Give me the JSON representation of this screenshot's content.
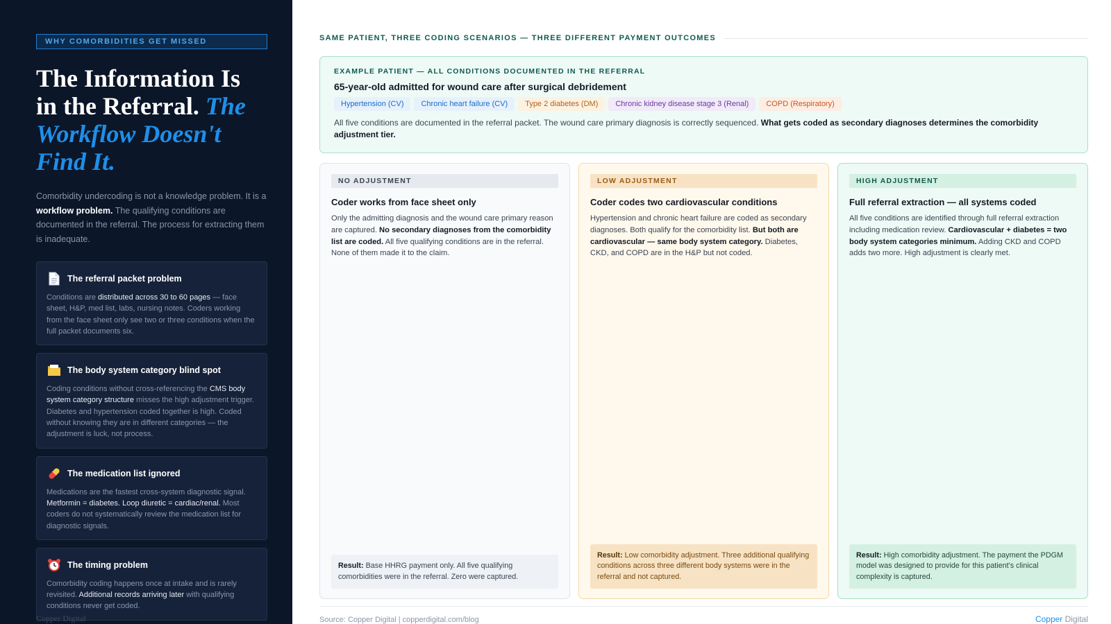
{
  "left": {
    "eyebrow": "WHY COMORBIDITIES GET MISSED",
    "headline_plain": "The Information Is in the Referral.",
    "headline_accent": "The Workflow Doesn't Find It.",
    "intro_1": "Comorbidity undercoding is not a knowledge problem. It is a",
    "intro_bold": "workflow problem.",
    "intro_2": "The qualifying conditions are documented in the referral. The process for extracting them is inadequate.",
    "cards": [
      {
        "icon": "document-icon",
        "title": "The referral packet problem",
        "body_1": "Conditions are",
        "body_hl": "distributed across 30 to 60 pages",
        "body_2": "— face sheet, H&P, med list, labs, nursing notes. Coders working from the face sheet only see two or three conditions when the full packet documents six."
      },
      {
        "icon": "folder-icon",
        "title": "The body system category blind spot",
        "body_1": "Coding conditions without cross-referencing the",
        "body_hl": "CMS body system category structure",
        "body_2": "misses the high adjustment trigger. Diabetes and hypertension coded together is high. Coded without knowing they are in different categories — the adjustment is luck, not process."
      },
      {
        "icon": "pill-icon",
        "title": "The medication list ignored",
        "body_1": "Medications are the fastest cross-system diagnostic signal.",
        "body_hl": "Metformin = diabetes. Loop diuretic = cardiac/renal.",
        "body_2": "Most coders do not systematically review the medication list for diagnostic signals."
      },
      {
        "icon": "alarm-clock-icon",
        "title": "The timing problem",
        "body_1": "Comorbidity coding happens once at intake and is rarely revisited.",
        "body_hl": "Additional records arriving later",
        "body_2": "with qualifying conditions never get coded."
      }
    ],
    "brand": "Copper Digital"
  },
  "right": {
    "section_label": "SAME PATIENT, THREE CODING SCENARIOS — THREE DIFFERENT PAYMENT OUTCOMES",
    "patient": {
      "eyebrow": "EXAMPLE PATIENT — ALL CONDITIONS DOCUMENTED IN THE REFERRAL",
      "title": "65-year-old admitted for wound care after surgical debridement",
      "chips": [
        {
          "label": "Hypertension (CV)",
          "kind": "cv"
        },
        {
          "label": "Chronic heart failure (CV)",
          "kind": "cv"
        },
        {
          "label": "Type 2 diabetes (DM)",
          "kind": "dm"
        },
        {
          "label": "Chronic kidney disease stage 3 (Renal)",
          "kind": "renal"
        },
        {
          "label": "COPD (Respiratory)",
          "kind": "resp"
        }
      ],
      "note_plain": "All five conditions are documented in the referral packet. The wound care primary diagnosis is correctly sequenced.",
      "note_bold": "What gets coded as secondary diagnoses determines the comorbidity adjustment tier."
    },
    "scenarios": [
      {
        "tag": "NO ADJUSTMENT",
        "title": "Coder works from face sheet only",
        "body_1": "Only the admitting diagnosis and the wound care primary reason are captured.",
        "body_bold": "No secondary diagnoses from the comorbidity list are coded.",
        "body_2": "All five qualifying conditions are in the referral. None of them made it to the claim.",
        "result_label": "Result:",
        "result_text": "Base HHRG payment only. All five qualifying comorbidities were in the referral. Zero were captured."
      },
      {
        "tag": "LOW ADJUSTMENT",
        "title": "Coder codes two cardiovascular conditions",
        "body_1": "Hypertension and chronic heart failure are coded as secondary diagnoses. Both qualify for the comorbidity list.",
        "body_bold": "But both are cardiovascular — same body system category.",
        "body_2": "Diabetes, CKD, and COPD are in the H&P but not coded.",
        "result_label": "Result:",
        "result_text": "Low comorbidity adjustment. Three additional qualifying conditions across three different body systems were in the referral and not captured."
      },
      {
        "tag": "HIGH ADJUSTMENT",
        "title": "Full referral extraction — all systems coded",
        "body_1": "All five conditions are identified through full referral extraction including medication review.",
        "body_bold": "Cardiovascular + diabetes = two body system categories minimum.",
        "body_2": "Adding CKD and COPD adds two more. High adjustment is clearly met.",
        "result_label": "Result:",
        "result_text": "High comorbidity adjustment. The payment the PDGM model was designed to provide for this patient's clinical complexity is captured."
      }
    ],
    "source": "Source: Copper Digital | copperdigital.com/blog",
    "brand_1": "Copper",
    "brand_2": "Digital"
  }
}
